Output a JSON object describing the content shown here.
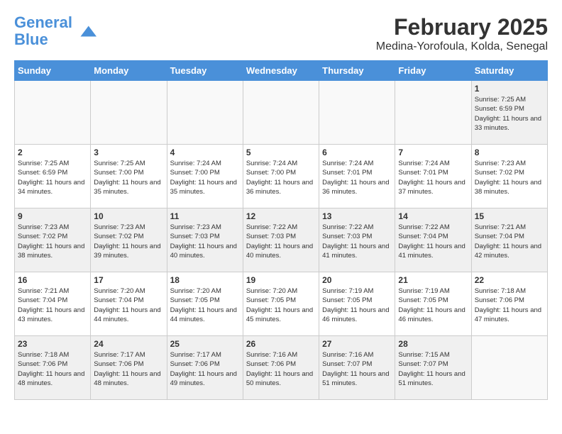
{
  "logo": {
    "line1": "General",
    "line2": "Blue"
  },
  "title": "February 2025",
  "location": "Medina-Yorofoula, Kolda, Senegal",
  "days_of_week": [
    "Sunday",
    "Monday",
    "Tuesday",
    "Wednesday",
    "Thursday",
    "Friday",
    "Saturday"
  ],
  "weeks": [
    [
      {
        "num": "",
        "info": ""
      },
      {
        "num": "",
        "info": ""
      },
      {
        "num": "",
        "info": ""
      },
      {
        "num": "",
        "info": ""
      },
      {
        "num": "",
        "info": ""
      },
      {
        "num": "",
        "info": ""
      },
      {
        "num": "1",
        "info": "Sunrise: 7:25 AM\nSunset: 6:59 PM\nDaylight: 11 hours and 33 minutes."
      }
    ],
    [
      {
        "num": "2",
        "info": "Sunrise: 7:25 AM\nSunset: 6:59 PM\nDaylight: 11 hours and 34 minutes."
      },
      {
        "num": "3",
        "info": "Sunrise: 7:25 AM\nSunset: 7:00 PM\nDaylight: 11 hours and 35 minutes."
      },
      {
        "num": "4",
        "info": "Sunrise: 7:24 AM\nSunset: 7:00 PM\nDaylight: 11 hours and 35 minutes."
      },
      {
        "num": "5",
        "info": "Sunrise: 7:24 AM\nSunset: 7:00 PM\nDaylight: 11 hours and 36 minutes."
      },
      {
        "num": "6",
        "info": "Sunrise: 7:24 AM\nSunset: 7:01 PM\nDaylight: 11 hours and 36 minutes."
      },
      {
        "num": "7",
        "info": "Sunrise: 7:24 AM\nSunset: 7:01 PM\nDaylight: 11 hours and 37 minutes."
      },
      {
        "num": "8",
        "info": "Sunrise: 7:23 AM\nSunset: 7:02 PM\nDaylight: 11 hours and 38 minutes."
      }
    ],
    [
      {
        "num": "9",
        "info": "Sunrise: 7:23 AM\nSunset: 7:02 PM\nDaylight: 11 hours and 38 minutes."
      },
      {
        "num": "10",
        "info": "Sunrise: 7:23 AM\nSunset: 7:02 PM\nDaylight: 11 hours and 39 minutes."
      },
      {
        "num": "11",
        "info": "Sunrise: 7:23 AM\nSunset: 7:03 PM\nDaylight: 11 hours and 40 minutes."
      },
      {
        "num": "12",
        "info": "Sunrise: 7:22 AM\nSunset: 7:03 PM\nDaylight: 11 hours and 40 minutes."
      },
      {
        "num": "13",
        "info": "Sunrise: 7:22 AM\nSunset: 7:03 PM\nDaylight: 11 hours and 41 minutes."
      },
      {
        "num": "14",
        "info": "Sunrise: 7:22 AM\nSunset: 7:04 PM\nDaylight: 11 hours and 41 minutes."
      },
      {
        "num": "15",
        "info": "Sunrise: 7:21 AM\nSunset: 7:04 PM\nDaylight: 11 hours and 42 minutes."
      }
    ],
    [
      {
        "num": "16",
        "info": "Sunrise: 7:21 AM\nSunset: 7:04 PM\nDaylight: 11 hours and 43 minutes."
      },
      {
        "num": "17",
        "info": "Sunrise: 7:20 AM\nSunset: 7:04 PM\nDaylight: 11 hours and 44 minutes."
      },
      {
        "num": "18",
        "info": "Sunrise: 7:20 AM\nSunset: 7:05 PM\nDaylight: 11 hours and 44 minutes."
      },
      {
        "num": "19",
        "info": "Sunrise: 7:20 AM\nSunset: 7:05 PM\nDaylight: 11 hours and 45 minutes."
      },
      {
        "num": "20",
        "info": "Sunrise: 7:19 AM\nSunset: 7:05 PM\nDaylight: 11 hours and 46 minutes."
      },
      {
        "num": "21",
        "info": "Sunrise: 7:19 AM\nSunset: 7:05 PM\nDaylight: 11 hours and 46 minutes."
      },
      {
        "num": "22",
        "info": "Sunrise: 7:18 AM\nSunset: 7:06 PM\nDaylight: 11 hours and 47 minutes."
      }
    ],
    [
      {
        "num": "23",
        "info": "Sunrise: 7:18 AM\nSunset: 7:06 PM\nDaylight: 11 hours and 48 minutes."
      },
      {
        "num": "24",
        "info": "Sunrise: 7:17 AM\nSunset: 7:06 PM\nDaylight: 11 hours and 48 minutes."
      },
      {
        "num": "25",
        "info": "Sunrise: 7:17 AM\nSunset: 7:06 PM\nDaylight: 11 hours and 49 minutes."
      },
      {
        "num": "26",
        "info": "Sunrise: 7:16 AM\nSunset: 7:06 PM\nDaylight: 11 hours and 50 minutes."
      },
      {
        "num": "27",
        "info": "Sunrise: 7:16 AM\nSunset: 7:07 PM\nDaylight: 11 hours and 51 minutes."
      },
      {
        "num": "28",
        "info": "Sunrise: 7:15 AM\nSunset: 7:07 PM\nDaylight: 11 hours and 51 minutes."
      },
      {
        "num": "",
        "info": ""
      }
    ]
  ]
}
